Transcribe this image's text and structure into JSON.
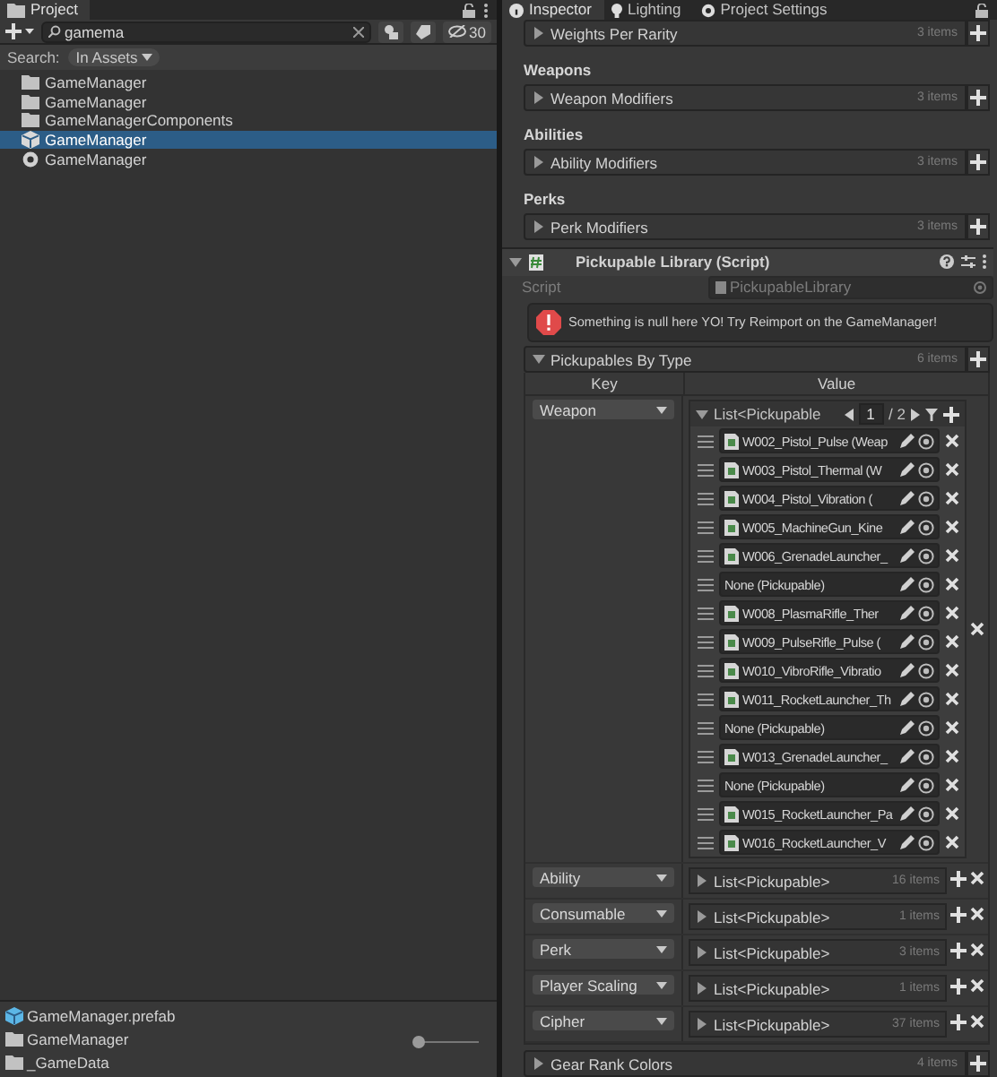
{
  "project_panel": {
    "tab": "Project",
    "search": {
      "value": "gamema"
    },
    "hidden_count": "30",
    "search_scope_label": "Search:",
    "search_scope": "In Assets",
    "results": [
      {
        "name": "GameManager",
        "kind": "folder",
        "selected": false
      },
      {
        "name": "GameManager",
        "kind": "folder",
        "selected": false
      },
      {
        "name": "GameManagerComponents",
        "kind": "folder",
        "selected": false
      },
      {
        "name": "GameManager",
        "kind": "prefab",
        "selected": true
      },
      {
        "name": "GameManager",
        "kind": "script",
        "selected": false
      }
    ],
    "footer_path": [
      {
        "name": "GameManager.prefab",
        "kind": "prefab"
      },
      {
        "name": "GameManager",
        "kind": "folder"
      },
      {
        "name": "_GameData",
        "kind": "folder"
      }
    ],
    "zoom_slider": {
      "level": 0.05
    }
  },
  "inspector": {
    "tabs": [
      {
        "label": "Inspector",
        "selected": true
      },
      {
        "label": "Lighting",
        "selected": false
      },
      {
        "label": "Project Settings",
        "selected": false
      }
    ],
    "lists": [
      {
        "label": "Weights Per Rarity",
        "count": "3 items"
      },
      {
        "heading": "Weapons",
        "label": "Weapon Modifiers",
        "count": "3 items"
      },
      {
        "heading": "Abilities",
        "label": "Ability Modifiers",
        "count": "3 items"
      },
      {
        "heading": "Perks",
        "label": "Perk Modifiers",
        "count": "3 items"
      }
    ],
    "component": {
      "title": "Pickupable Library (Script)",
      "expanded": true,
      "script_label": "Script",
      "script_value": "PickupableLibrary",
      "warning": "Something is null here YO! Try Reimport on the GameManager!",
      "dictionary": {
        "label": "Pickupables By Type",
        "count": "6 items",
        "expanded": true,
        "key_header": "Key",
        "value_header": "Value",
        "entries": [
          {
            "key": "Weapon",
            "list_label": "List<Pickupable",
            "expanded": true,
            "page": "1",
            "page_total": "/ 2",
            "items": [
              {
                "name": "W002_Pistol_Pulse (Weap",
                "kind": "asset"
              },
              {
                "name": "W003_Pistol_Thermal (W",
                "kind": "asset"
              },
              {
                "name": "W004_Pistol_Vibration (",
                "kind": "asset"
              },
              {
                "name": "W005_MachineGun_Kine",
                "kind": "asset"
              },
              {
                "name": "W006_GrenadeLauncher_",
                "kind": "asset"
              },
              {
                "name": "None (Pickupable)",
                "kind": "none"
              },
              {
                "name": "W008_PlasmaRifle_Ther",
                "kind": "asset"
              },
              {
                "name": "W009_PulseRifle_Pulse (",
                "kind": "asset"
              },
              {
                "name": "W010_VibroRifle_Vibratio",
                "kind": "asset"
              },
              {
                "name": "W011_RocketLauncher_Th",
                "kind": "asset"
              },
              {
                "name": "None (Pickupable)",
                "kind": "none"
              },
              {
                "name": "W013_GrenadeLauncher_",
                "kind": "asset"
              },
              {
                "name": "None (Pickupable)",
                "kind": "none"
              },
              {
                "name": "W015_RocketLauncher_Pa",
                "kind": "asset"
              },
              {
                "name": "W016_RocketLauncher_V",
                "kind": "asset"
              }
            ]
          },
          {
            "key": "Ability",
            "list_label": "List<Pickupable>",
            "expanded": false,
            "count": "16 items"
          },
          {
            "key": "Consumable",
            "list_label": "List<Pickupable>",
            "expanded": false,
            "count": "1 items"
          },
          {
            "key": "Perk",
            "list_label": "List<Pickupable>",
            "expanded": false,
            "count": "3 items"
          },
          {
            "key": "Player Scaling",
            "list_label": "List<Pickupable>",
            "expanded": false,
            "count": "1 items"
          },
          {
            "key": "Cipher",
            "list_label": "List<Pickupable>",
            "expanded": false,
            "count": "37 items"
          }
        ]
      },
      "gear_rank_colors": {
        "label": "Gear Rank Colors",
        "count": "4 items",
        "expanded": false
      }
    }
  }
}
